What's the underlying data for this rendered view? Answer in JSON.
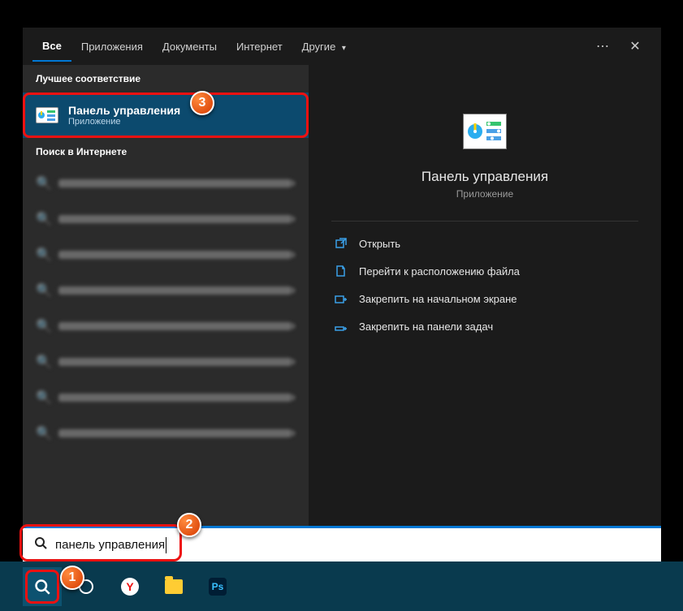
{
  "tabs": {
    "all": "Все",
    "apps": "Приложения",
    "docs": "Документы",
    "web": "Интернет",
    "more": "Другие"
  },
  "left": {
    "best_header": "Лучшее соответствие",
    "best_title": "Панель управления",
    "best_sub": "Приложение",
    "web_header": "Поиск в Интернете"
  },
  "preview": {
    "title": "Панель управления",
    "sub": "Приложение",
    "actions": {
      "open": "Открыть",
      "location": "Перейти к расположению файла",
      "pin_start": "Закрепить на начальном экране",
      "pin_taskbar": "Закрепить на панели задач"
    }
  },
  "search": {
    "value": "панель управления"
  },
  "badges": {
    "b1": "1",
    "b2": "2",
    "b3": "3"
  },
  "taskbar": {
    "ps": "Ps",
    "y": "Y"
  }
}
